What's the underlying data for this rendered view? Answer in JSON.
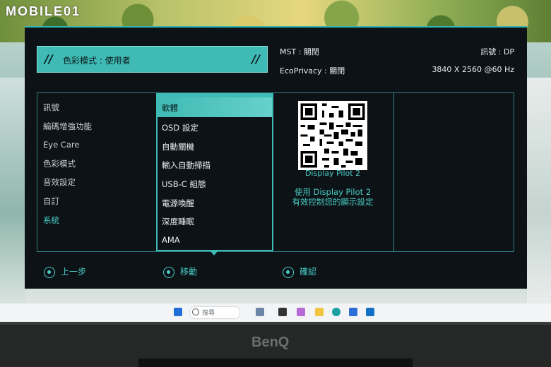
{
  "watermark": "MOBILE01",
  "osd": {
    "mode_label": "色彩模式 : 使用者",
    "mst": "MST : 關閉",
    "signal_source": "訊號 : DP",
    "ecoprivacy": "EcoPrivacy : 關閉",
    "resolution": "3840 X 2560 @60 Hz",
    "main_menu": [
      {
        "label": "訊號",
        "active": false
      },
      {
        "label": "編碼增強功能",
        "active": false
      },
      {
        "label": "Eye Care",
        "active": false
      },
      {
        "label": "色彩模式",
        "active": false
      },
      {
        "label": "音效設定",
        "active": false
      },
      {
        "label": "自訂",
        "active": false
      },
      {
        "label": "系統",
        "active": true
      }
    ],
    "submenu": [
      "軟體",
      "OSD 設定",
      "自動關機",
      "輸入自動掃描",
      "USB-C 組態",
      "電源喚醒",
      "深度睡眠",
      "AMA"
    ],
    "submenu_selected": "軟體",
    "qr_caption": "Display Pilot 2",
    "qr_desc_line1": "使用 Display Pilot 2",
    "qr_desc_line2": "有效控制您的顯示設定",
    "footer": {
      "back": "上一步",
      "move": "移動",
      "confirm": "確認"
    }
  },
  "taskbar": {
    "search_placeholder": "搜尋"
  },
  "monitor_brand": "BenQ"
}
